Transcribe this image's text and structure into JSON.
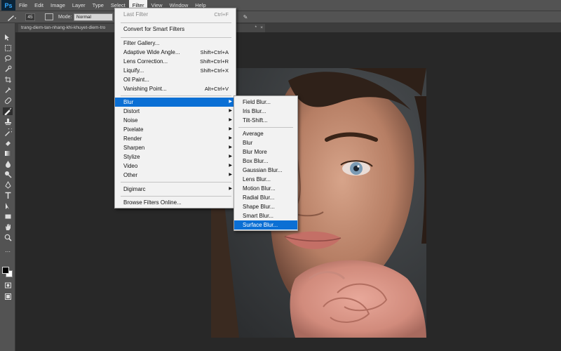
{
  "app": {
    "logo": "Ps"
  },
  "menubar": {
    "items": [
      "File",
      "Edit",
      "Image",
      "Layer",
      "Type",
      "Select",
      "Filter",
      "View",
      "Window",
      "Help"
    ],
    "active": "Filter"
  },
  "options": {
    "brush_size": "45",
    "mode_label": "Mode:",
    "mode_value": "Normal"
  },
  "document_tab": {
    "title": "trang-diem-tan-nhang-khi-khuyet-diem-tro",
    "suffix": "*",
    "close": "×"
  },
  "filter_menu": {
    "last_filter": {
      "label": "Last Filter",
      "shortcut": "Ctrl+F",
      "disabled": true
    },
    "convert_smart": "Convert for Smart Filters",
    "filter_gallery": "Filter Gallery...",
    "adaptive_wide_angle": {
      "label": "Adaptive Wide Angle...",
      "shortcut": "Shift+Ctrl+A"
    },
    "lens_correction": {
      "label": "Lens Correction...",
      "shortcut": "Shift+Ctrl+R"
    },
    "liquify": {
      "label": "Liquify...",
      "shortcut": "Shift+Ctrl+X"
    },
    "oil_paint": "Oil Paint...",
    "vanishing_point": {
      "label": "Vanishing Point...",
      "shortcut": "Alt+Ctrl+V"
    },
    "submenus": [
      "Blur",
      "Distort",
      "Noise",
      "Pixelate",
      "Render",
      "Sharpen",
      "Stylize",
      "Video",
      "Other"
    ],
    "digimarc": "Digimarc",
    "browse_online": "Browse Filters Online..."
  },
  "blur_submenu": {
    "gallery_items": [
      "Field Blur...",
      "Iris Blur...",
      "Tilt-Shift..."
    ],
    "items": [
      "Average",
      "Blur",
      "Blur More",
      "Box Blur...",
      "Gaussian Blur...",
      "Lens Blur...",
      "Motion Blur...",
      "Radial Blur...",
      "Shape Blur...",
      "Smart Blur...",
      "Surface Blur..."
    ],
    "highlighted": "Surface Blur..."
  },
  "colors": {
    "foreground": "#000000",
    "background": "#ffffff",
    "highlight": "#0b6fd4"
  }
}
